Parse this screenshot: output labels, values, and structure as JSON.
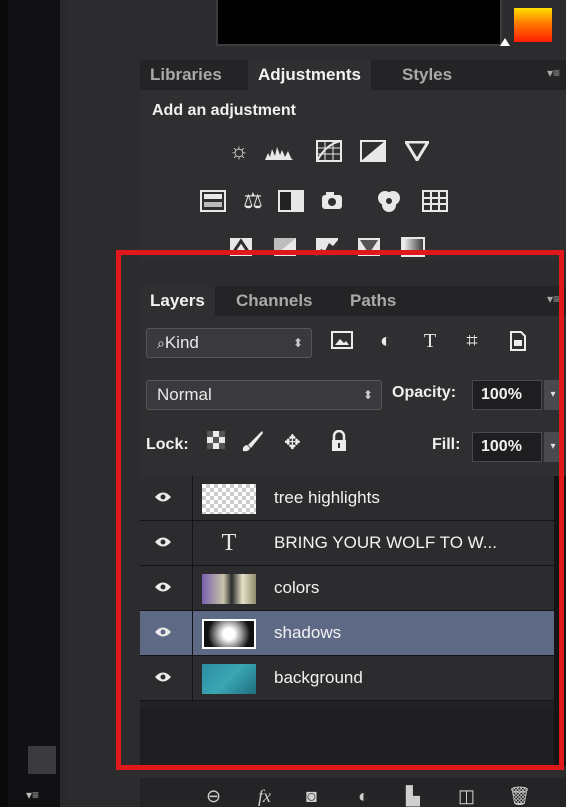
{
  "adjustments_panel": {
    "tabs": [
      {
        "label": "Libraries",
        "active": false
      },
      {
        "label": "Adjustments",
        "active": true
      },
      {
        "label": "Styles",
        "active": false
      }
    ],
    "title": "Add an adjustment",
    "icons_row1": [
      "brightness-contrast",
      "levels",
      "curves",
      "exposure",
      "vibrance"
    ],
    "icons_row2": [
      "hue-saturation",
      "color-balance",
      "black-white",
      "photo-filter",
      "channel-mixer",
      "color-lookup"
    ],
    "icons_row3": [
      "invert",
      "posterize",
      "threshold",
      "selective-color",
      "gradient-map"
    ]
  },
  "layers_panel": {
    "tabs": [
      {
        "label": "Layers",
        "active": true
      },
      {
        "label": "Channels",
        "active": false
      },
      {
        "label": "Paths",
        "active": false
      }
    ],
    "filter_kind": "Kind",
    "blend_mode": "Normal",
    "opacity_label": "Opacity:",
    "opacity_value": "100%",
    "lock_label": "Lock:",
    "fill_label": "Fill:",
    "fill_value": "100%",
    "layers": [
      {
        "name": "tree highlights",
        "type": "transparent",
        "selected": false
      },
      {
        "name": "BRING YOUR WOLF TO W...",
        "type": "text",
        "selected": false
      },
      {
        "name": "colors",
        "type": "image",
        "selected": false
      },
      {
        "name": "shadows",
        "type": "image",
        "selected": true
      },
      {
        "name": "background",
        "type": "image",
        "selected": false
      }
    ],
    "text_layer_glyph": "T"
  },
  "colors": {
    "highlight_box": "#e0181b",
    "selected_row": "#5e6a85",
    "panel_bg": "#2f2f32"
  }
}
